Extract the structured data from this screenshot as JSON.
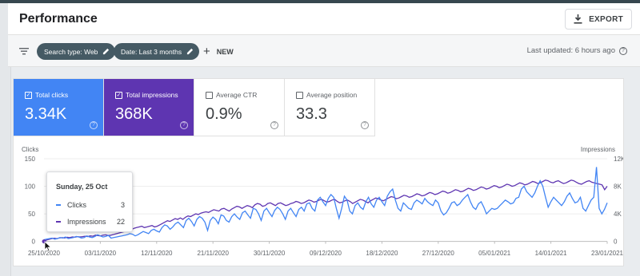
{
  "header": {
    "title": "Performance",
    "export_label": "EXPORT"
  },
  "filters": {
    "chips": [
      {
        "label": "Search type: Web"
      },
      {
        "label": "Date: Last 3 months"
      }
    ],
    "new_label": "NEW",
    "last_updated": "Last updated: 6 hours ago"
  },
  "metrics": {
    "clicks": {
      "label": "Total clicks",
      "value": "3.34K",
      "checked": true,
      "color": "#4285f4"
    },
    "impressions": {
      "label": "Total impressions",
      "value": "368K",
      "checked": true,
      "color": "#5e35b1"
    },
    "ctr": {
      "label": "Average CTR",
      "value": "0.9%",
      "checked": false
    },
    "position": {
      "label": "Average position",
      "value": "33.3",
      "checked": false
    }
  },
  "tooltip": {
    "date": "Sunday, 25 Oct",
    "rows": [
      {
        "name": "Clicks",
        "value": "3"
      },
      {
        "name": "Impressions",
        "value": "22"
      }
    ]
  },
  "chart_data": {
    "type": "line",
    "left_axis_label": "Clicks",
    "right_axis_label": "Impressions",
    "left_ylim": [
      0,
      150
    ],
    "right_ylim": [
      0,
      12000
    ],
    "left_ticks": [
      "150",
      "100",
      "50",
      "0"
    ],
    "right_ticks": [
      "12K",
      "8K",
      "4K",
      "0"
    ],
    "x_tick_labels": [
      "25/10/2020",
      "03/11/2020",
      "12/11/2020",
      "21/11/2020",
      "30/11/2020",
      "09/12/2020",
      "18/12/2020",
      "27/12/2020",
      "05/01/2021",
      "14/01/2021",
      "23/01/2021"
    ],
    "grid": true,
    "series": [
      {
        "name": "Clicks",
        "color": "#4285f4",
        "axis": "left",
        "values": [
          3,
          4,
          5,
          6,
          4,
          5,
          7,
          6,
          8,
          5,
          6,
          7,
          9,
          8,
          6,
          7,
          10,
          8,
          7,
          9,
          12,
          10,
          8,
          9,
          11,
          6,
          7,
          8,
          9,
          10,
          11,
          12,
          14,
          13,
          10,
          12,
          15,
          18,
          16,
          14,
          20,
          22,
          19,
          17,
          25,
          30,
          28,
          22,
          26,
          32,
          35,
          30,
          25,
          38,
          42,
          36,
          28,
          40,
          45,
          42,
          35,
          20,
          38,
          44,
          40,
          32,
          48,
          46,
          38,
          35,
          45,
          50,
          44,
          40,
          52,
          55,
          48,
          42,
          60,
          58,
          50,
          38,
          55,
          60,
          52,
          45,
          56,
          62,
          58,
          50,
          40,
          55,
          60,
          52,
          45,
          58,
          62,
          55,
          68,
          70,
          60,
          55,
          75,
          80,
          72,
          65,
          78,
          85,
          80,
          60,
          42,
          60,
          82,
          75,
          55,
          50,
          65,
          70,
          62,
          58,
          72,
          80,
          68,
          62,
          75,
          80,
          72,
          65,
          82,
          90,
          95,
          75,
          60,
          55,
          70,
          65,
          60,
          58,
          70,
          75,
          72,
          68,
          78,
          72,
          68,
          65,
          75,
          70,
          55,
          48,
          52,
          60,
          70,
          72,
          65,
          68,
          75,
          80,
          85,
          72,
          62,
          58,
          68,
          72,
          62,
          50,
          55,
          60,
          58,
          60,
          65,
          70,
          75,
          72,
          68,
          70,
          78,
          80,
          95,
          100,
          90,
          85,
          80,
          88,
          100,
          110,
          100,
          80,
          62,
          72,
          80,
          75,
          70,
          65,
          72,
          82,
          88,
          78,
          70,
          72,
          80,
          60,
          55,
          65,
          75,
          80,
          135,
          60,
          50,
          58,
          70
        ],
        "note": "values estimated"
      },
      {
        "name": "Impressions",
        "color": "#5e35b1",
        "axis": "right",
        "values": [
          22,
          200,
          300,
          400,
          450,
          400,
          500,
          550,
          500,
          600,
          550,
          650,
          600,
          700,
          650,
          700,
          750,
          700,
          800,
          750,
          900,
          850,
          800,
          900,
          950,
          850,
          900,
          1000,
          1100,
          1200,
          1300,
          1400,
          1500,
          1600,
          1700,
          1900,
          2000,
          2100,
          2200,
          2000,
          2100,
          2200,
          2300,
          2100,
          2200,
          2400,
          2600,
          2800,
          3000,
          2900,
          3100,
          3300,
          3200,
          3400,
          3200,
          3500,
          3700,
          3600,
          3800,
          4000,
          3900,
          4100,
          4200,
          4300,
          4200,
          4400,
          4600,
          4500,
          4400,
          4700,
          4800,
          4600,
          4400,
          4700,
          4900,
          5100,
          5000,
          4800,
          5000,
          5200,
          5100,
          4900,
          5300,
          5500,
          5400,
          5100,
          5200,
          5500,
          5600,
          5400,
          5200,
          5500,
          5600,
          5400,
          5200,
          5300,
          5500,
          5600,
          5800,
          5700,
          5500,
          5600,
          5800,
          6000,
          5900,
          5700,
          5800,
          6000,
          6100,
          5900,
          5700,
          5800,
          6000,
          6100,
          5800,
          5600,
          5700,
          5900,
          6000,
          5800,
          5500,
          5700,
          5900,
          6100,
          6000,
          5800,
          5600,
          5900,
          6100,
          6300,
          6200,
          6000,
          5900,
          6100,
          6300,
          6500,
          6400,
          6200,
          6300,
          6500,
          6700,
          6600,
          6400,
          6500,
          6700,
          6900,
          6800,
          6600,
          6700,
          6900,
          7100,
          7000,
          6800,
          6900,
          7100,
          7300,
          7200,
          7000,
          7100,
          7300,
          7500,
          7400,
          7200,
          7300,
          7500,
          7700,
          7600,
          7400,
          7500,
          7700,
          7900,
          7800,
          7600,
          7700,
          7900,
          8100,
          8000,
          7800,
          7900,
          8100,
          8300,
          8200,
          8000,
          8100,
          8300,
          8500,
          8400,
          8200,
          8300,
          8500,
          8700,
          8600,
          8400,
          8500,
          8700,
          8900,
          8800,
          8600,
          8500,
          8700,
          8800,
          8600,
          8400,
          8500,
          8700,
          8900,
          8800,
          8600,
          8400,
          8300,
          8500,
          8700,
          8800,
          8600,
          8500,
          8400,
          8300,
          8200,
          7500,
          8000
        ],
        "note": "values estimated"
      }
    ]
  }
}
